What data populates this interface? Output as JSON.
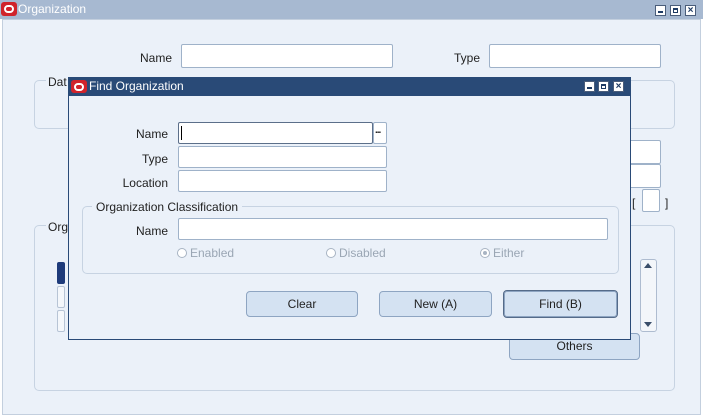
{
  "main_window": {
    "title": "Organization",
    "name_label": "Name",
    "type_label": "Type",
    "dates_label_partial": "Dat",
    "org_group_label_partial": "Org",
    "bracket_left": "[",
    "bracket_right": "]",
    "others_button": "Others"
  },
  "dialog": {
    "title": "Find Organization",
    "name_label": "Name",
    "type_label": "Type",
    "location_label": "Location",
    "ellipsis": "...",
    "classification": {
      "group_label": "Organization Classification",
      "name_label": "Name",
      "radios": [
        {
          "label": "Enabled",
          "selected": false
        },
        {
          "label": "Disabled",
          "selected": false
        },
        {
          "label": "Either",
          "selected": true
        }
      ]
    },
    "buttons": {
      "clear": "Clear",
      "new": "New (A)",
      "find": "Find (B)"
    }
  },
  "colors": {
    "window_bg": "#ebf1f9",
    "main_title_bar": "#a7b9d1",
    "dialog_title_bar": "#294a77",
    "button_bg": "#d4e2f2",
    "oracle_red": "#d0232b"
  }
}
